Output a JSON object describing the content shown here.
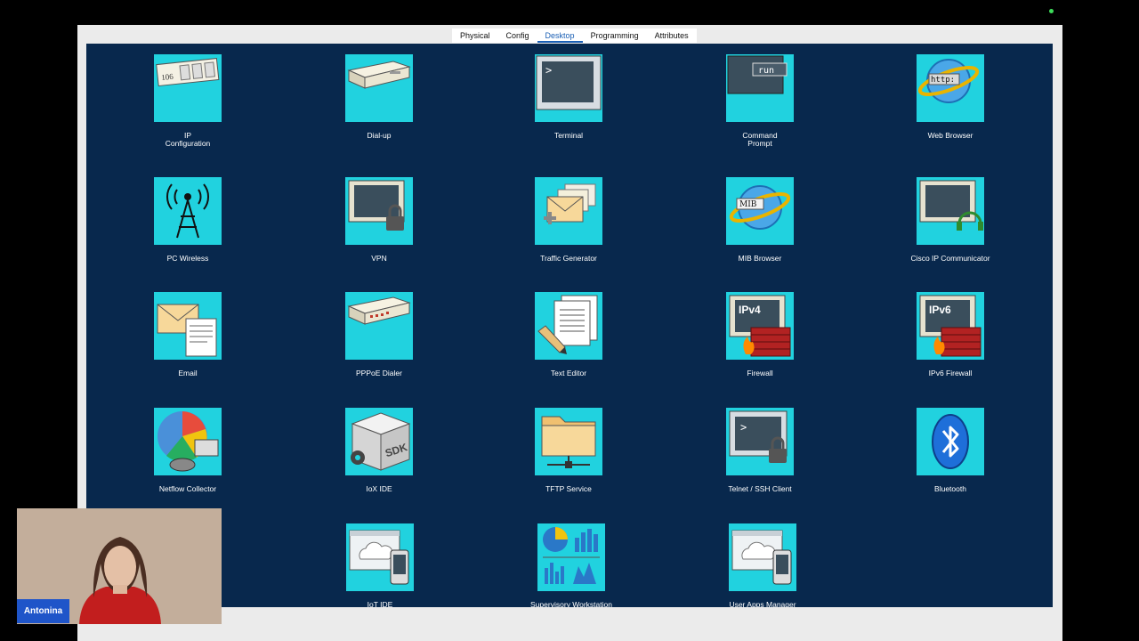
{
  "tabs": [
    {
      "label": "Physical"
    },
    {
      "label": "Config"
    },
    {
      "label": "Desktop",
      "active": true
    },
    {
      "label": "Programming"
    },
    {
      "label": "Attributes"
    }
  ],
  "apps": [
    {
      "label": "IP\nConfiguration",
      "icon": "ip-configuration-icon",
      "icon_text": "106"
    },
    {
      "label": "Dial-up",
      "icon": "dialup-modem-icon"
    },
    {
      "label": "Terminal",
      "icon": "terminal-icon",
      "icon_text": ">"
    },
    {
      "label": "Command\nPrompt",
      "icon": "command-prompt-icon",
      "icon_text": "run"
    },
    {
      "label": "Web Browser",
      "icon": "web-browser-icon",
      "icon_text": "http:"
    },
    {
      "label": "PC Wireless",
      "icon": "wireless-antenna-icon"
    },
    {
      "label": "VPN",
      "icon": "vpn-monitor-lock-icon"
    },
    {
      "label": "Traffic Generator",
      "icon": "traffic-generator-envelopes-icon"
    },
    {
      "label": "MIB Browser",
      "icon": "mib-browser-icon",
      "icon_text": "MIB"
    },
    {
      "label": "Cisco IP Communicator",
      "icon": "ip-communicator-headset-icon"
    },
    {
      "label": "Email",
      "icon": "email-icon"
    },
    {
      "label": "PPPoE Dialer",
      "icon": "pppoe-dialer-icon"
    },
    {
      "label": "Text Editor",
      "icon": "text-editor-icon"
    },
    {
      "label": "Firewall",
      "icon": "firewall-icon",
      "icon_text": "IPv4"
    },
    {
      "label": "IPv6 Firewall",
      "icon": "ipv6-firewall-icon",
      "icon_text": "IPv6"
    },
    {
      "label": "Netflow Collector",
      "icon": "netflow-pie-chart-icon"
    },
    {
      "label": "IoX IDE",
      "icon": "iox-sdk-box-icon",
      "icon_text": "SDK"
    },
    {
      "label": "TFTP Service",
      "icon": "tftp-folder-icon"
    },
    {
      "label": "Telnet / SSH Client",
      "icon": "telnet-ssh-icon",
      "icon_text": ">"
    },
    {
      "label": "Bluetooth",
      "icon": "bluetooth-icon"
    },
    {
      "label": "IoT IDE",
      "icon": "iot-ide-cloud-phone-icon"
    },
    {
      "label": "Supervisory Workstation",
      "icon": "supervisory-charts-icon"
    },
    {
      "label": "User Apps Manager",
      "icon": "user-apps-cloud-phone-icon"
    }
  ],
  "participant": {
    "name": "Antonina"
  },
  "colors": {
    "desktop_bg": "#08284d",
    "icon_bg": "#21d2df",
    "tab_active": "#1a5fb4",
    "name_tag": "#1f55c9"
  }
}
